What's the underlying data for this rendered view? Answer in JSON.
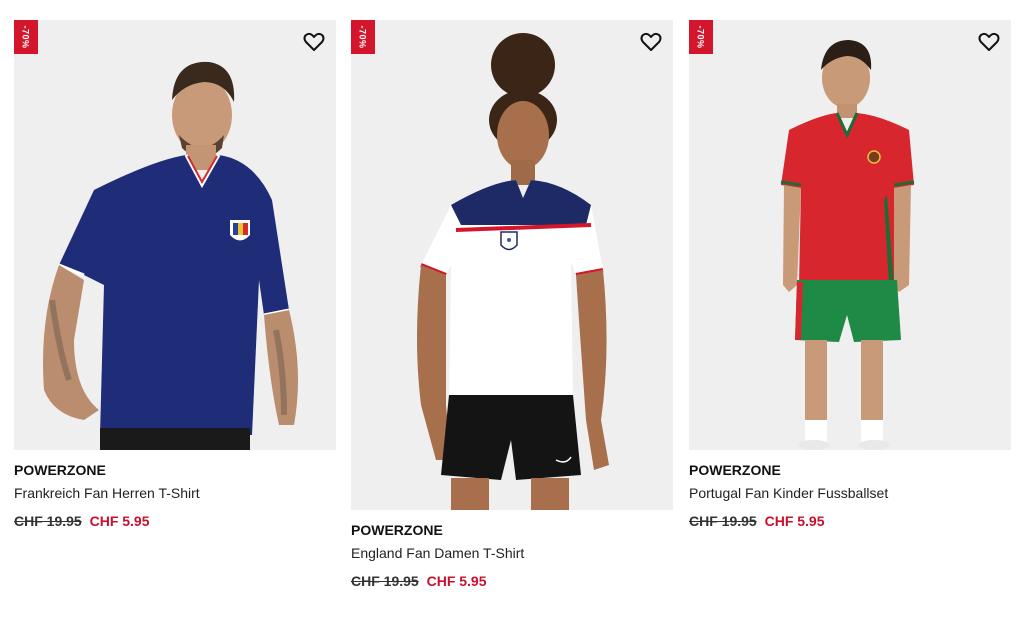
{
  "colors": {
    "badge": "#d4162c",
    "sale_price": "#c8102e"
  },
  "products": [
    {
      "badge": "-70%",
      "brand": "POWERZONE",
      "name": "Frankreich Fan Herren T-Shirt",
      "old_price": "CHF 19.95",
      "new_price": "CHF 5.95",
      "wishlist_icon": "heart-icon"
    },
    {
      "badge": "-70%",
      "brand": "POWERZONE",
      "name": "England Fan Damen T-Shirt",
      "old_price": "CHF 19.95",
      "new_price": "CHF 5.95",
      "wishlist_icon": "heart-icon"
    },
    {
      "badge": "-70%",
      "brand": "POWERZONE",
      "name": "Portugal Fan Kinder Fussballset",
      "old_price": "CHF 19.95",
      "new_price": "CHF 5.95",
      "wishlist_icon": "heart-icon"
    }
  ]
}
